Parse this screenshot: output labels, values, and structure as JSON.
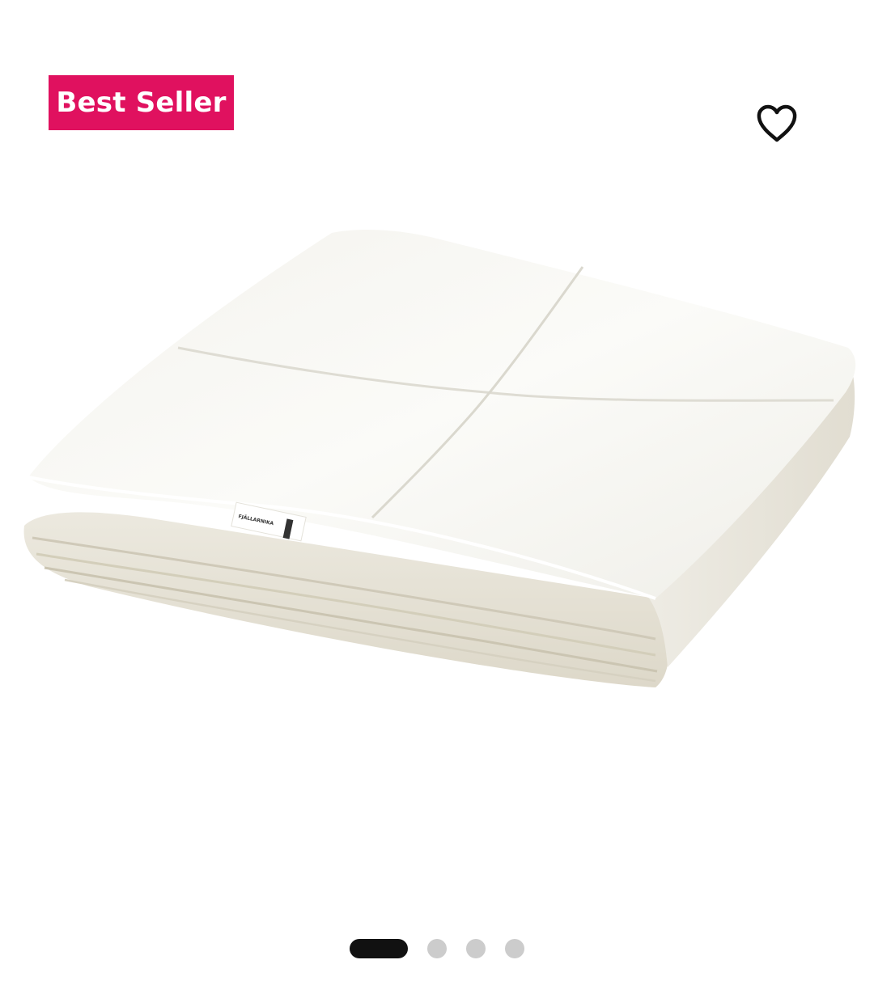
{
  "badge": {
    "label": "Best Seller",
    "color": "#e0115f"
  },
  "favorite": {
    "icon": "heart-outline-icon"
  },
  "product": {
    "image": "folded-white-duvet-image",
    "tag_text": "FJÄLLARNIKA"
  },
  "carousel": {
    "slide_count": 4,
    "active_index": 0
  }
}
